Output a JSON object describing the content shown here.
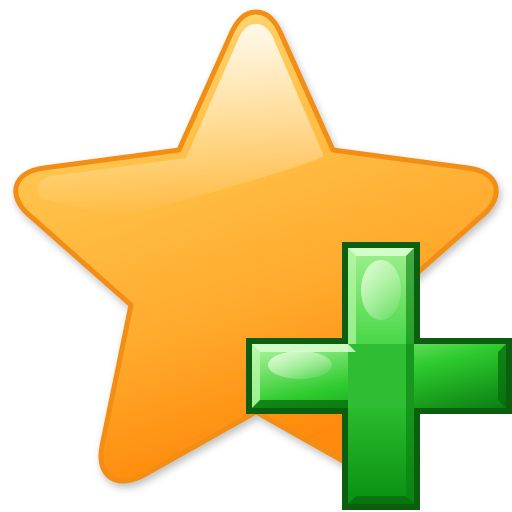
{
  "icon": {
    "name": "add-to-favorites-icon",
    "parts": {
      "star": "star-icon",
      "plus": "plus-icon"
    },
    "colors": {
      "star_light": "#ffe08a",
      "star_mid": "#ffb52e",
      "star_dark": "#ff8a0a",
      "star_outline": "#f28d12",
      "plus_light": "#9ff08e",
      "plus_mid": "#2ecb2e",
      "plus_dark": "#0a8f12",
      "plus_outline": "#0b5f0e"
    }
  }
}
